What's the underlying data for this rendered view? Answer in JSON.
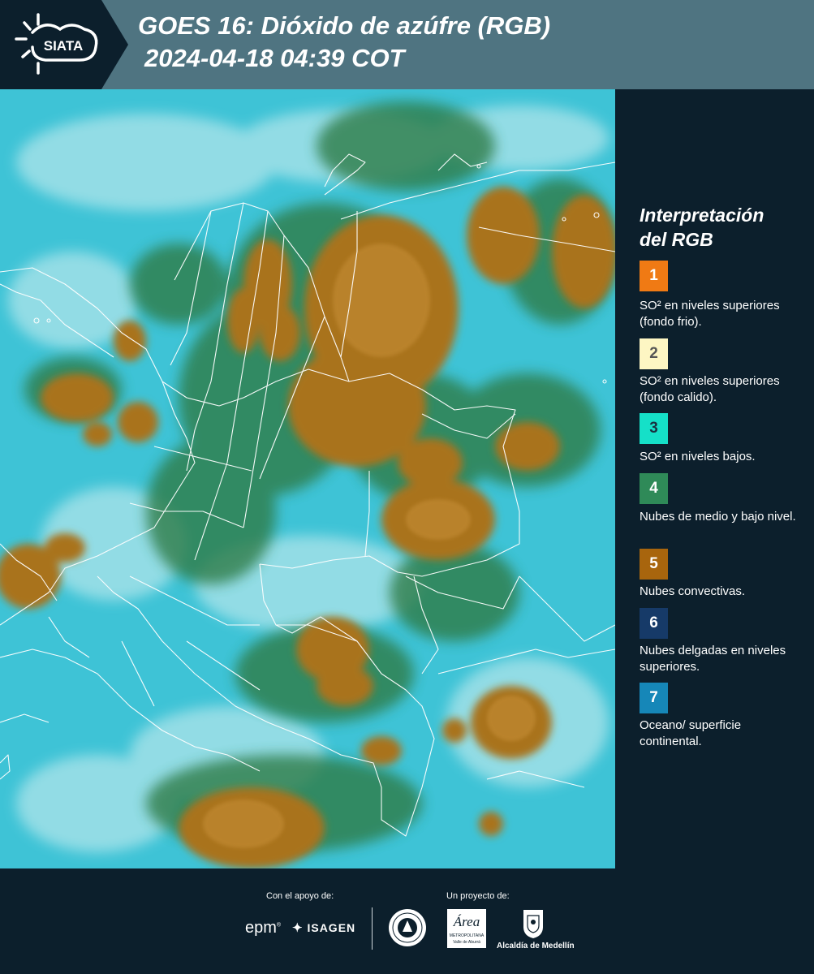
{
  "header": {
    "logo_text": "SIATA",
    "title_line1": "GOES 16: Dióxido de azúfre (RGB)",
    "title_line2": "2024-04-18 04:39 COT"
  },
  "legend": {
    "title_line1": "Interpretación",
    "title_line2": "del RGB",
    "items": [
      {
        "number": "1",
        "color": "#f07a14",
        "text_color": "#ffffff",
        "description": "SO² en niveles superiores (fondo frio)."
      },
      {
        "number": "2",
        "color": "#fdf6c3",
        "text_color": "#555555",
        "description": "SO² en niveles superiores (fondo calido)."
      },
      {
        "number": "3",
        "color": "#15e0c8",
        "text_color": "#1a3040",
        "description": "SO² en niveles bajos."
      },
      {
        "number": "4",
        "color": "#2f8a58",
        "text_color": "#ffffff",
        "description": "Nubes de medio y bajo nivel."
      },
      {
        "number": "5",
        "color": "#a8650d",
        "text_color": "#ffffff",
        "description": "Nubes convectivas."
      },
      {
        "number": "6",
        "color": "#163a68",
        "text_color": "#ffffff",
        "description": "Nubes delgadas en niveles superiores."
      },
      {
        "number": "7",
        "color": "#1687b8",
        "text_color": "#ffffff",
        "description": "Oceano/ superficie continental."
      }
    ]
  },
  "footer": {
    "support_label": "Con el apoyo de:",
    "project_label": "Un proyecto de:",
    "sponsors": [
      "epm",
      "ISAGEN"
    ],
    "partners": [
      "Área Metropolitana Valle de Aburrá",
      "Alcaldía de Medellín"
    ],
    "area_word": "Área",
    "area_sub1": "METROPOLITANA",
    "area_sub2": "Valle de Aburrá",
    "alcaldia_label": "Alcaldía de Medellín"
  },
  "colors": {
    "header_bg": "#4f7481",
    "panel_bg": "#0c1f2c",
    "ocean": "#3ec3d6",
    "cloud_green": "#2f7c47",
    "convective": "#a9731b"
  }
}
